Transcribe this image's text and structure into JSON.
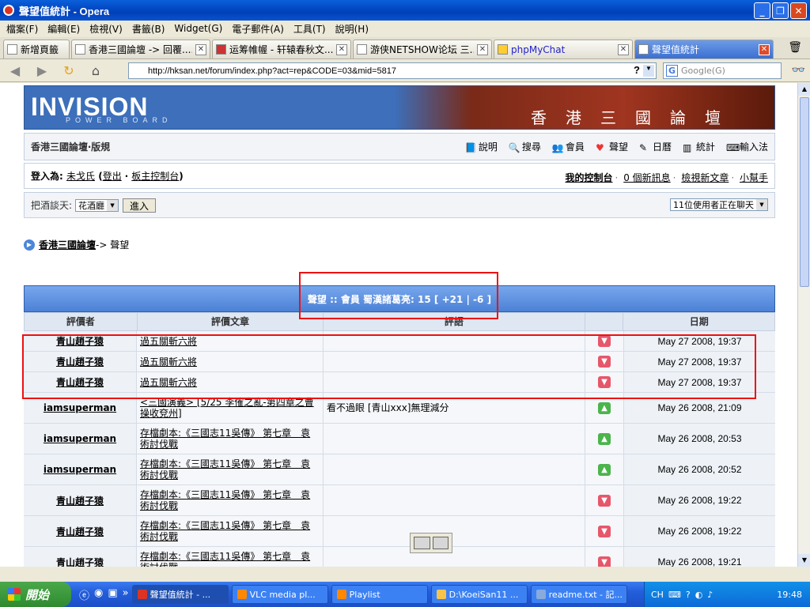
{
  "window": {
    "title": "聲望值統計 - Opera"
  },
  "menu": [
    "檔案(F)",
    "編輯(E)",
    "檢視(V)",
    "書籤(B)",
    "Widget(G)",
    "電子郵件(A)",
    "工具(T)",
    "說明(H)"
  ],
  "tabs": [
    {
      "label": "新增頁籤"
    },
    {
      "label": "香港三國論壇 -> 回覆....."
    },
    {
      "label": "运筹帷幄 - 轩辕春秋文..."
    },
    {
      "label": "游侠NETSHOW论坛 三..."
    },
    {
      "label": "phpMyChat"
    },
    {
      "label": "聲望值統計"
    }
  ],
  "address": {
    "url": "http://hksan.net/forum/index.php?act=rep&CODE=03&mid=5817",
    "search_placeholder": "Google(G)"
  },
  "banner": {
    "logo": "INVISION",
    "logo_sub": "POWER BOARD",
    "title": "香港三國論壇"
  },
  "forum": {
    "title": "香港三國論壇‧版規",
    "nav": [
      "說明",
      "搜尋",
      "會員",
      "聲望",
      "日曆",
      "統計",
      "輸入法"
    ],
    "login_prefix": "登入為:",
    "user": "未戈氏",
    "logout": "登出",
    "admin": "板主控制台",
    "my_panel": "我的控制台",
    "messages": "0 個新訊息",
    "new_posts": "檢視新文章",
    "helper": "小幫手",
    "chat_label": "把酒談天:",
    "chat_room": "花酒廳",
    "enter": "進入",
    "chat_users": "11位使用者正在聊天"
  },
  "breadcrumb": {
    "home": "香港三國論壇",
    "current": "-> 聲望"
  },
  "table": {
    "header": "聲望 :: 會員 蜀漢諸葛亮: 15 [ +21 | -6 ]",
    "columns": [
      "評價者",
      "評價文章",
      "評語",
      "",
      "日期"
    ],
    "rows": [
      {
        "rater": "青山趙子猿",
        "article": "過五關斬六將",
        "comment": "",
        "vote": "down",
        "date": "May 27 2008, 19:37"
      },
      {
        "rater": "青山趙子猿",
        "article": "過五關斬六將",
        "comment": "",
        "vote": "down",
        "date": "May 27 2008, 19:37"
      },
      {
        "rater": "青山趙子猿",
        "article": "過五關斬六將",
        "comment": "",
        "vote": "down",
        "date": "May 27 2008, 19:37"
      },
      {
        "rater": "iamsuperman",
        "article": "<三國演義> [5/25 李傕之亂-第四章之曹操收兗州]",
        "comment": "看不過眼 [青山xxx]無理減分",
        "vote": "up",
        "date": "May 26 2008, 21:09"
      },
      {
        "rater": "iamsuperman",
        "article": "存檔劇本:《三國志11吳傳》 第七章　袁術討伐戰",
        "comment": "",
        "vote": "up",
        "date": "May 26 2008, 20:53"
      },
      {
        "rater": "iamsuperman",
        "article": "存檔劇本:《三國志11吳傳》 第七章　袁術討伐戰",
        "comment": "",
        "vote": "up",
        "date": "May 26 2008, 20:52"
      },
      {
        "rater": "青山趙子猿",
        "article": "存檔劇本:《三國志11吳傳》 第七章　袁術討伐戰",
        "comment": "",
        "vote": "down",
        "date": "May 26 2008, 19:22"
      },
      {
        "rater": "青山趙子猿",
        "article": "存檔劇本:《三國志11吳傳》 第七章　袁術討伐戰",
        "comment": "",
        "vote": "down",
        "date": "May 26 2008, 19:22"
      },
      {
        "rater": "青山趙子猿",
        "article": "存檔劇本:《三國志11吳傳》 第七章　袁術討伐戰",
        "comment": "",
        "vote": "down",
        "date": "May 26 2008, 19:21"
      }
    ]
  },
  "taskbar": {
    "start": "開始",
    "tasks": [
      "聲望值統計 - ...",
      "VLC media pl...",
      "Playlist",
      "D:\\KoeiSan11 ...",
      "readme.txt - 記..."
    ],
    "clock": "19:48",
    "ime": "CH"
  },
  "colors": {
    "accent": "#4c81d6",
    "highlight": "#ee1111",
    "down_vote": "#e6576b",
    "up_vote": "#4cb44c"
  }
}
